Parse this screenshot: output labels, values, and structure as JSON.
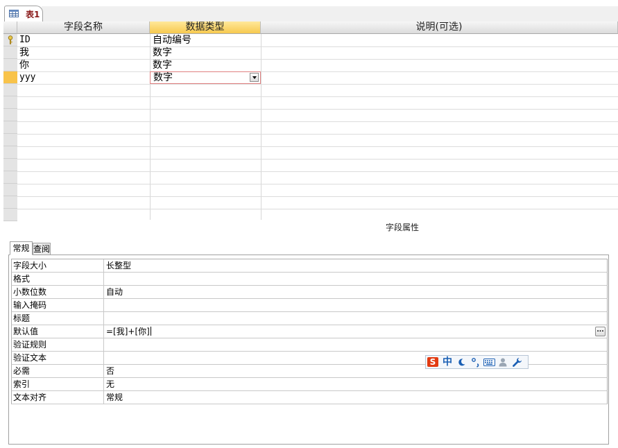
{
  "document_tab": {
    "label": "表1"
  },
  "grid": {
    "headers": {
      "field_name": "字段名称",
      "data_type": "数据类型",
      "description": "说明(可选)"
    },
    "rows": [
      {
        "field_name": "ID",
        "data_type": "自动编号",
        "is_primary_key": true
      },
      {
        "field_name": "我",
        "data_type": "数字"
      },
      {
        "field_name": "你",
        "data_type": "数字"
      },
      {
        "field_name": "yyy",
        "data_type": "数字",
        "is_current": true
      }
    ]
  },
  "field_properties": {
    "title": "字段属性",
    "tabs": [
      {
        "label": "常规",
        "active": true
      },
      {
        "label": "查阅",
        "active": false
      }
    ],
    "rows": [
      {
        "label": "字段大小",
        "value": "长整型"
      },
      {
        "label": "格式",
        "value": ""
      },
      {
        "label": "小数位数",
        "value": "自动"
      },
      {
        "label": "输入掩码",
        "value": ""
      },
      {
        "label": "标题",
        "value": ""
      },
      {
        "label": "默认值",
        "value": "=[我]+[你]"
      },
      {
        "label": "验证规则",
        "value": ""
      },
      {
        "label": "验证文本",
        "value": ""
      },
      {
        "label": "必需",
        "value": "否"
      },
      {
        "label": "索引",
        "value": "无"
      },
      {
        "label": "文本对齐",
        "value": "常规"
      }
    ]
  },
  "ime_toolbar": {
    "logo": "S",
    "mode": "中",
    "items": [
      "moon-icon",
      "punctuation-icon",
      "keyboard-icon",
      "user-icon",
      "wrench-icon"
    ]
  },
  "colors": {
    "selected_header": "#f7c94f",
    "current_row": "#f8c34a",
    "tab_label": "#8a1a1a"
  }
}
